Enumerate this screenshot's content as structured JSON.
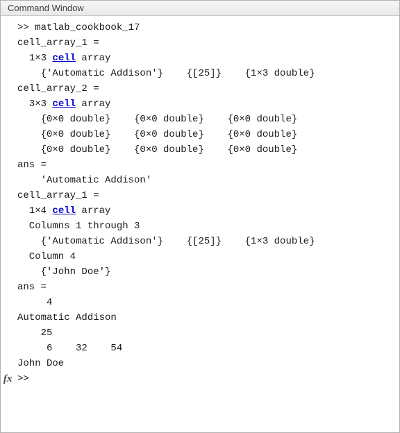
{
  "window": {
    "title": "Command Window"
  },
  "prompt": ">> ",
  "command": "matlab_cookbook_17",
  "lines": {
    "l01": "cell_array_1 =",
    "l02_pre": "  1×3 ",
    "l02_link": "cell",
    "l02_post": " array",
    "l03": "    {'Automatic Addison'}    {[25]}    {1×3 double}",
    "l04": "cell_array_2 =",
    "l05_pre": "  3×3 ",
    "l05_link": "cell",
    "l05_post": " array",
    "l06": "    {0×0 double}    {0×0 double}    {0×0 double}",
    "l07": "    {0×0 double}    {0×0 double}    {0×0 double}",
    "l08": "    {0×0 double}    {0×0 double}    {0×0 double}",
    "l09": "ans =",
    "l10": "    'Automatic Addison'",
    "l11": "cell_array_1 =",
    "l12_pre": "  1×4 ",
    "l12_link": "cell",
    "l12_post": " array",
    "l13": "  Columns 1 through 3",
    "l14": "    {'Automatic Addison'}    {[25]}    {1×3 double}",
    "l15": "  Column 4",
    "l16": "    {'John Doe'}",
    "l17": "ans =",
    "l18": "     4",
    "l19": "Automatic Addison",
    "l20": "    25",
    "l21": "     6    32    54",
    "l22": "John Doe"
  },
  "fx_label": "fx"
}
